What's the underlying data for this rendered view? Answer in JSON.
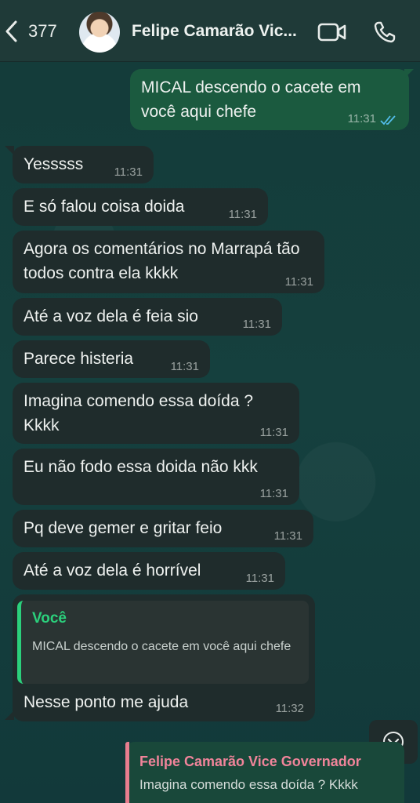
{
  "header": {
    "back_count": "377",
    "contact_name": "Felipe Camarão Vic..."
  },
  "messages": [
    {
      "text": "MICAL descendo o cacete em você aqui chefe",
      "time": "11:31",
      "direction": "out",
      "status": "read"
    },
    {
      "text": "Yesssss",
      "time": "11:31",
      "direction": "in"
    },
    {
      "text": "E só falou coisa doida",
      "time": "11:31",
      "direction": "in"
    },
    {
      "text": "Agora os comentários no Marrapá tão todos contra ela kkkk",
      "time": "11:31",
      "direction": "in"
    },
    {
      "text": "Até a voz dela é feia sio",
      "time": "11:31",
      "direction": "in"
    },
    {
      "text": "Parece histeria",
      "time": "11:31",
      "direction": "in"
    },
    {
      "text": "Imagina comendo essa doída ? Kkkk",
      "time": "11:31",
      "direction": "in"
    },
    {
      "text": "Eu não fodo essa doida não kkk",
      "time": "11:31",
      "direction": "in"
    },
    {
      "text": "Pq deve gemer e gritar feio",
      "time": "11:31",
      "direction": "in"
    },
    {
      "text": "Até a voz dela é horrível",
      "time": "11:31",
      "direction": "in"
    },
    {
      "text": "Nesse ponto me ajuda",
      "time": "11:32",
      "direction": "in",
      "quote": {
        "author": "Você",
        "text": "MICAL descendo o cacete em você aqui chefe"
      }
    }
  ],
  "reply_preview": {
    "author": "Felipe Camarão Vice Governador",
    "text": "Imagina comendo essa doída ? Kkkk"
  },
  "colors": {
    "incoming_bubble": "#1f2c2c",
    "outgoing_bubble": "#1b5a3f",
    "quote_accent": "#2bd07c",
    "reply_accent": "#f0849a",
    "read_ticks": "#53bdeb"
  },
  "icons": [
    "back-chevron-icon",
    "video-call-icon",
    "phone-call-icon",
    "read-ticks-icon",
    "scroll-down-icon"
  ]
}
